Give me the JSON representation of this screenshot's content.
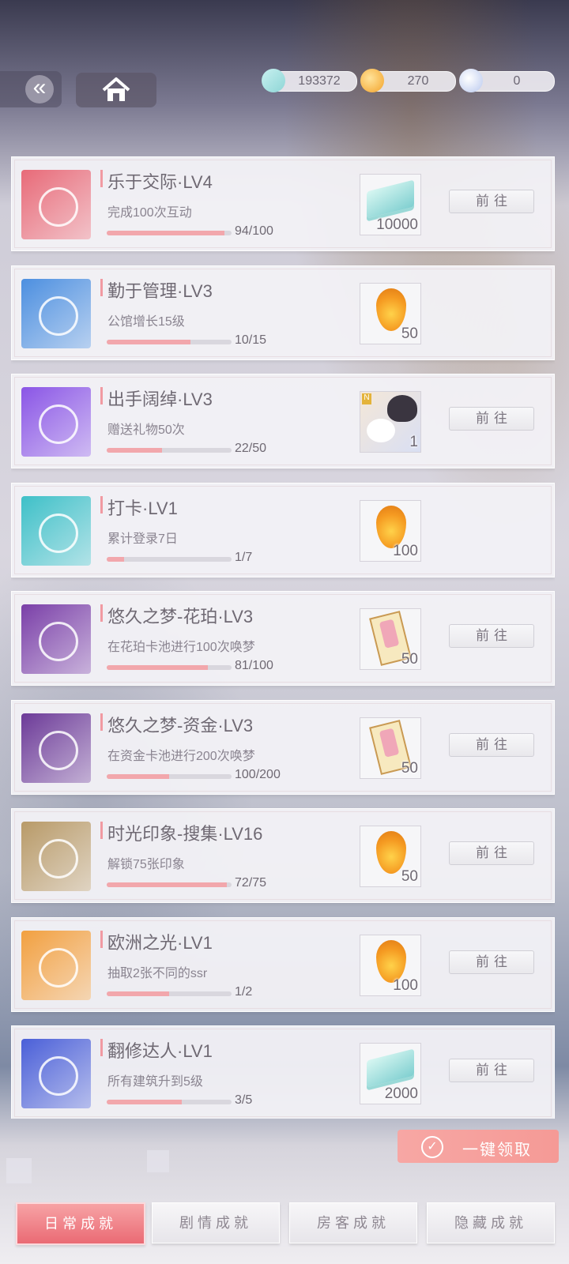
{
  "currency": [
    {
      "icon": "cash-stack-icon",
      "value": "193372"
    },
    {
      "icon": "amber-gem-icon",
      "value": "270"
    },
    {
      "icon": "ticket-crystal-icon",
      "value": "0"
    }
  ],
  "achievements": [
    {
      "title": "乐于交际·LV4",
      "desc": "完成100次互动",
      "progress": "94/100",
      "fraction": 0.94,
      "icon": "chat-bubbles-icon",
      "icon_color": "#e86a78",
      "reward_icon": "cash-stack-icon",
      "reward_qty": "10000",
      "go_label": "前往",
      "show_go": true
    },
    {
      "title": "勤于管理·LV3",
      "desc": "公馆增长15级",
      "progress": "10/15",
      "fraction": 0.667,
      "icon": "gear-emblem-icon",
      "icon_color": "#4c8fe0",
      "reward_icon": "amber-gem-icon",
      "reward_qty": "50",
      "go_label": "",
      "show_go": false
    },
    {
      "title": "出手阔绰·LV3",
      "desc": "赠送礼物50次",
      "progress": "22/50",
      "fraction": 0.44,
      "icon": "coin-ring-icon",
      "icon_color": "#8a55e6",
      "reward_icon": "cat-card-icon",
      "reward_qty": "1",
      "go_label": "前往",
      "show_go": true
    },
    {
      "title": "打卡·LV1",
      "desc": "累计登录7日",
      "progress": "1/7",
      "fraction": 0.143,
      "icon": "check-calendar-icon",
      "icon_color": "#3ec0c8",
      "reward_icon": "amber-gem-icon",
      "reward_qty": "100",
      "go_label": "",
      "show_go": false
    },
    {
      "title": "悠久之梦-花珀·LV3",
      "desc": "在花珀卡池进行100次唤梦",
      "progress": "81/100",
      "fraction": 0.81,
      "icon": "flower-badge-icon",
      "icon_color": "#7a3fa8",
      "reward_icon": "charm-tag-icon",
      "reward_qty": "50",
      "go_label": "前往",
      "show_go": true
    },
    {
      "title": "悠久之梦-资金·LV3",
      "desc": "在资金卡池进行200次唤梦",
      "progress": "100/200",
      "fraction": 0.5,
      "icon": "dollar-badge-icon",
      "icon_color": "#6c3a98",
      "reward_icon": "charm-tag-icon",
      "reward_qty": "50",
      "go_label": "前往",
      "show_go": true
    },
    {
      "title": "时光印象-搜集·LV16",
      "desc": "解锁75张印象",
      "progress": "72/75",
      "fraction": 0.96,
      "icon": "unlock-cards-icon",
      "icon_color": "#b89a68",
      "reward_icon": "amber-gem-icon",
      "reward_qty": "50",
      "go_label": "前往",
      "show_go": true
    },
    {
      "title": "欧洲之光·LV1",
      "desc": "抽取2张不同的ssr",
      "progress": "1/2",
      "fraction": 0.5,
      "icon": "crown-light-icon",
      "icon_color": "#f2a040",
      "reward_icon": "amber-gem-icon",
      "reward_qty": "100",
      "go_label": "前往",
      "show_go": true
    },
    {
      "title": "翻修达人·LV1",
      "desc": "所有建筑升到5级",
      "progress": "3/5",
      "fraction": 0.6,
      "icon": "tools-icon",
      "icon_color": "#4a5fd8",
      "reward_icon": "cash-stack-icon",
      "reward_qty": "2000",
      "go_label": "前往",
      "show_go": true
    }
  ],
  "claim_all_label": "一键领取",
  "tabs": [
    {
      "label": "日常成就",
      "active": true
    },
    {
      "label": "剧情成就",
      "active": false
    },
    {
      "label": "房客成就",
      "active": false
    },
    {
      "label": "隐藏成就",
      "active": false
    }
  ]
}
